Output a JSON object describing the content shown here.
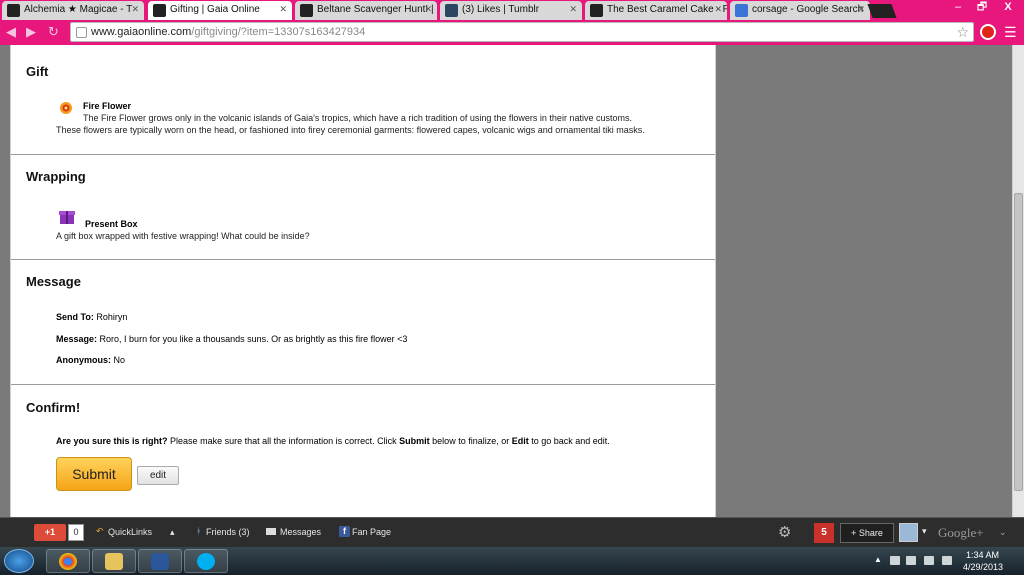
{
  "browser": {
    "tabs": [
      {
        "label": "Alchemia ★ Magicae - T",
        "active": false,
        "favicon": "gaia-icon"
      },
      {
        "label": "Gifting | Gaia Online",
        "active": true,
        "favicon": "gaia-icon"
      },
      {
        "label": "Beltane Scavenger Hunt! |",
        "active": false,
        "favicon": "gaia-icon"
      },
      {
        "label": "(3) Likes | Tumblr",
        "active": false,
        "favicon": "tumblr-icon"
      },
      {
        "label": "The Best Caramel Cake - F",
        "active": false,
        "favicon": "page-icon"
      },
      {
        "label": "corsage - Google Search",
        "active": false,
        "favicon": "google-icon"
      }
    ],
    "url_host": "www.gaiaonline.com",
    "url_path": "/giftgiving/?item=13307s163427934",
    "window_controls": {
      "minimize": "–",
      "maximize": "🗗",
      "close": "X"
    },
    "accent_color": "#e8177e"
  },
  "gift": {
    "title": "Gift",
    "item_name": "Fire Flower",
    "desc_line1": "The Fire Flower grows only in the volcanic islands of Gaia's tropics, which have a rich tradition of using the flowers in their native customs.",
    "desc_line2": "These flowers are typically worn on the head, or fashioned into firey ceremonial garments: flowered capes, volcanic wigs and ornamental tiki masks."
  },
  "wrapping": {
    "title": "Wrapping",
    "item_name": "Present Box",
    "desc": "A gift box wrapped with festive wrapping! What could be inside?"
  },
  "message": {
    "title": "Message",
    "send_to_label": "Send To:",
    "send_to_value": "Rohiryn",
    "message_label": "Message:",
    "message_value": "Roro, I burn for you like a thousands suns. Or as brightly as this fire flower <3",
    "anonymous_label": "Anonymous:",
    "anonymous_value": "No"
  },
  "confirm": {
    "title": "Confirm!",
    "question": "Are you sure this is right?",
    "text_a": "Please make sure that all the information is correct. Click",
    "submit_word": "Submit",
    "text_b": "below to finalize, or",
    "edit_word": "Edit",
    "text_c": "to go back and edit.",
    "submit_label": "Submit",
    "edit_label": "edit"
  },
  "gaiabar": {
    "gplus_label": "+1",
    "gplus_count": "0",
    "quicklinks": "QuickLinks",
    "quicklinks_caret": "▴",
    "friends": "Friends (3)",
    "messages": "Messages",
    "fanpage": "Fan Page",
    "notifications": "5",
    "share": "+ Share",
    "googleplus": "Google+"
  },
  "taskbar": {
    "apps": [
      "chrome",
      "file-explorer",
      "word",
      "skype"
    ],
    "time": "1:34 AM",
    "date": "4/29/2013"
  }
}
